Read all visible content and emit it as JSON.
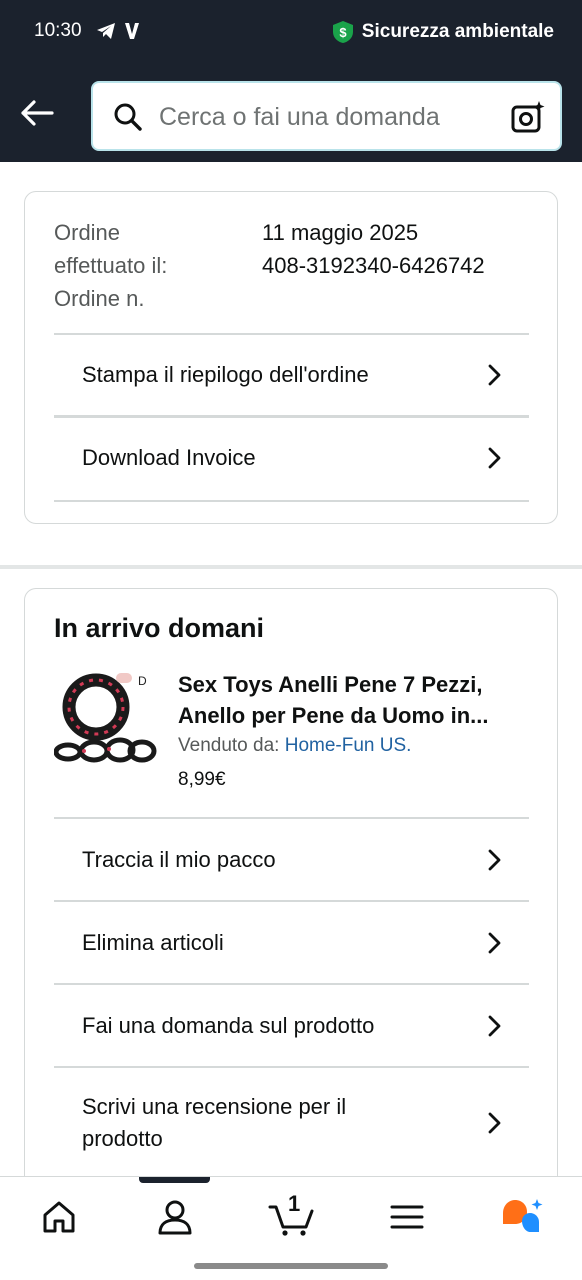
{
  "status_bar": {
    "time": "10:30",
    "security_label": "Sicurezza ambientale"
  },
  "search": {
    "placeholder": "Cerca o fai una domanda"
  },
  "order_card": {
    "labels": [
      "Ordine",
      "effettuato il:",
      "Ordine n."
    ],
    "date": "11 maggio 2025",
    "order_number": "408-3192340-6426742",
    "actions": [
      {
        "label": "Stampa il riepilogo dell'ordine"
      },
      {
        "label": "Download Invoice"
      }
    ]
  },
  "shipment_card": {
    "title": "In arrivo domani",
    "product": {
      "title_line1": "Sex Toys Anelli Pene 7 Pezzi,",
      "title_line2": "Anello per Pene da Uomo in...",
      "seller_prefix": "Venduto da:",
      "seller_name": "Home-Fun US.",
      "price": "8,99€"
    },
    "actions": [
      {
        "label": "Traccia il mio pacco"
      },
      {
        "label": "Elimina articoli"
      },
      {
        "label": "Fai una domanda sul prodotto"
      },
      {
        "label_line1": "Scrivi una recensione per il",
        "label_line2": "prodotto"
      }
    ]
  },
  "bottom_nav": {
    "cart_count": "1",
    "items": [
      "home-icon",
      "account-icon",
      "cart-icon",
      "menu-icon",
      "rufus-icon"
    ]
  },
  "colors": {
    "header_bg": "#1b222d",
    "link": "#2162a1",
    "shield_green": "#1aa34a",
    "rufus_orange": "#ff6f17",
    "rufus_blue": "#1f8fff"
  }
}
